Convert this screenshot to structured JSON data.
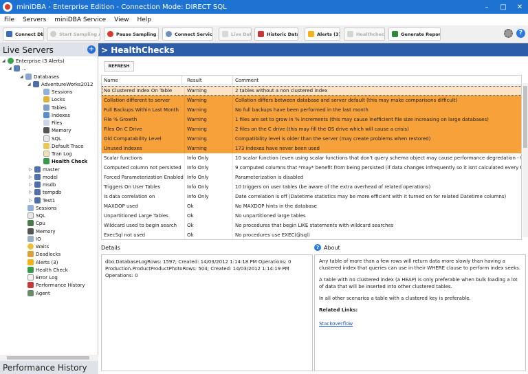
{
  "window": {
    "title": "miniDBA - Enterprise Edition - Connection Mode: DIRECT SQL",
    "controls": [
      "–",
      "□",
      "✕"
    ]
  },
  "menu": [
    "File",
    "Servers",
    "miniDBA Service",
    "View",
    "Help"
  ],
  "toolbar": {
    "connect_db": "Connect Db",
    "start_sampling_all": "Start Sampling All",
    "pause_sampling_all": "Pause Sampling All",
    "connect_service": "Connect Service",
    "live_data": "Live Data",
    "historic_data": "Historic Data",
    "alerts": "Alerts (3)",
    "healthcheck": "Healthcheck",
    "generate_reports": "Generate Reports"
  },
  "left_panel": {
    "title": "Live Servers",
    "footer": "Performance History",
    "tree": [
      "Enterprise (3 Alerts)",
      "...",
      "Databases",
      "AdventureWorks2012",
      "Sessions",
      "Locks",
      "Tables",
      "Indexes",
      "Files",
      "Memory",
      "SQL",
      "Default Trace",
      "Tran Log",
      "Health Check",
      "master",
      "model",
      "msdb",
      "tempdb",
      "Test1",
      "Sessions",
      "SQL",
      "Cpu",
      "Memory",
      "IO",
      "Waits",
      "Deadlocks",
      "Alerts (3)",
      "Health Check",
      "Error Log",
      "Performance History",
      "Agent"
    ]
  },
  "main": {
    "title": "> HealthChecks",
    "refresh": "REFRESH",
    "columns": [
      "Name",
      "Result",
      "Comment"
    ],
    "rows": [
      {
        "name": "No Clustered Index On Table",
        "result": "Warning",
        "comment": "2 tables without a non clustered index"
      },
      {
        "name": "Collation different to server",
        "result": "Warning",
        "comment": "Collation differs between database and server default (this may make comparisons difficult)"
      },
      {
        "name": "Full Backups Within Last Month",
        "result": "Warning",
        "comment": "No full backups have been performed in the last month"
      },
      {
        "name": "File % Growth",
        "result": "Warning",
        "comment": "1 files are set to grow in % increments (this may cause inefficient file size increasing on large databases)"
      },
      {
        "name": "Files On C Drive",
        "result": "Warning",
        "comment": "2 files on the C drive (this may fill the OS drive which will cause a crisis)"
      },
      {
        "name": "Old Compatability Level",
        "result": "Warning",
        "comment": "Compatibility level is older than the server (may create problems when restored)"
      },
      {
        "name": "Unused Indexes",
        "result": "Warning",
        "comment": "173 indexes have never been used"
      },
      {
        "name": "Scalar functions",
        "result": "Info Only",
        "comment": "10 scalar function (even using scalar functions that don't query schema object may cause performance degredation - test re"
      },
      {
        "name": "Computed column not persisted",
        "result": "Info Only",
        "comment": "9 computed columns that *may* benefit from being persisted (if data changes infrequently so it isnt calculated every time it"
      },
      {
        "name": "Forced Parameterization Enabled",
        "result": "Info Only",
        "comment": "Parameterization is disabled"
      },
      {
        "name": "Triggers On User Tables",
        "result": "Info Only",
        "comment": "10 triggers on user tables (be aware of the extra overhead of related operations)"
      },
      {
        "name": "Is data correlation on",
        "result": "Info Only",
        "comment": "Date correlation is off (Datetime statistics may be more efficient with it turned on for related Datetime columns)"
      },
      {
        "name": "MAXDOP used",
        "result": "Ok",
        "comment": "No MAXDOP hints in the database"
      },
      {
        "name": "Unpartitioned Large Tables",
        "result": "Ok",
        "comment": "No unpartitioned large tables"
      },
      {
        "name": "Wildcard used to begin search",
        "result": "Ok",
        "comment": "No procedures that begin LIKE statements with wildcard searches"
      },
      {
        "name": "ExecSql not used",
        "result": "Ok",
        "comment": "No procedures use EXEC(@sql)"
      }
    ],
    "details_label": "Details",
    "details_lines": [
      "dbo.DatabaseLogRows: 1597;    Created: 14/03/2012 1:14:18 PM    Operations: 0",
      "Production.ProductProductPhotoRows: 504;    Created: 14/03/2012 1:14:19 PM",
      "Operations: 0"
    ],
    "about_label": "About",
    "about_p1": "Any table of more than a few rows will return data more slowly than having a clustered index that queries can use in their WHERE clause to perform index seeks.",
    "about_p2": "A table with no clustered index (a HEAP) is only preferable when bulk loading a lot of data that will be inserted into other clustered tables.",
    "about_p3": "In all other scenarios a table with a clustered key is preferable.",
    "related_links": "Related Links:",
    "link": "Stackoverflow"
  },
  "colors": {
    "titlebar": "#1e73d2",
    "main_header": "#2d5da8",
    "warning_row": "#f7a13a",
    "selected_row": "#fbe4c5"
  }
}
